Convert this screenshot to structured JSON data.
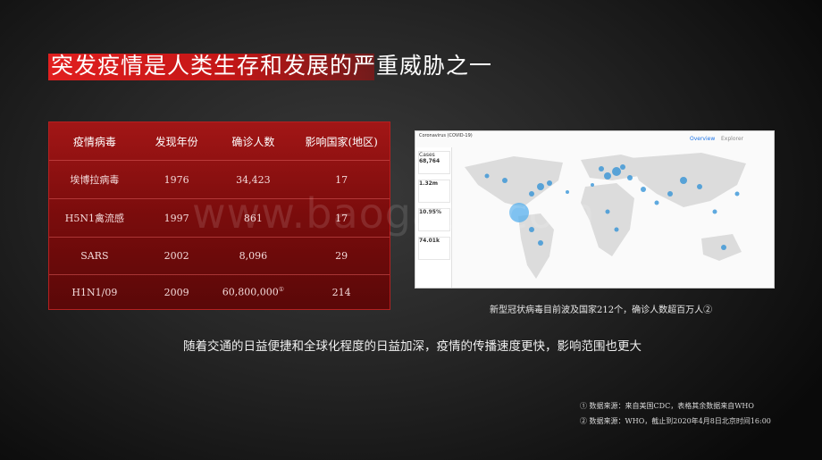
{
  "slide": {
    "title": "突发疫情是人类生存和发展的严重威胁之一",
    "table": {
      "headers": [
        "疫情病毒",
        "发现年份",
        "确诊人数",
        "影响国家(地区)"
      ],
      "rows": [
        [
          "埃博拉病毒",
          "1976",
          "34,423",
          "17"
        ],
        [
          "H5N1禽流感",
          "1997",
          "861",
          "17"
        ],
        [
          "SARS",
          "2002",
          "8,096",
          "29"
        ],
        [
          "H1N1/09",
          "2009",
          "60,800,000",
          "214"
        ]
      ],
      "h1n1_mark": "①"
    },
    "map": {
      "title": "Coronavirus (COVID-19)",
      "tab_overview": "Overview",
      "tab_explorer": "Explorer",
      "cards": [
        "68,764",
        "1.32m",
        "10.95%",
        "74.01k"
      ],
      "cases_label": "Cases"
    },
    "map_caption": "新型冠状病毒目前波及国家212个，确诊人数超百万人②",
    "subtitle": "随着交通的日益便捷和全球化程度的日益加深，疫情的传播速度更快，影响范围也更大",
    "notes": [
      "① 数据来源：来自美国CDC，表格其余数据来自WHO",
      "② 数据来源：WHO，截止到2020年4月8日北京时间16:00"
    ],
    "watermark": "www.baogao8.com"
  }
}
